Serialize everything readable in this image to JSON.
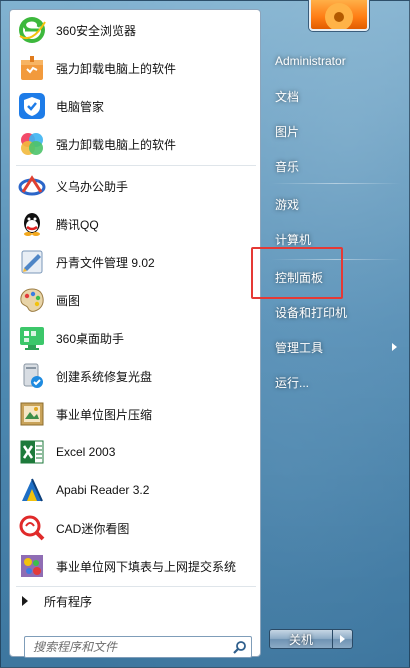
{
  "programs": [
    {
      "label": "360安全浏览器",
      "icon": "360-browser-icon"
    },
    {
      "label": "强力卸载电脑上的软件",
      "icon": "uninstall-box-icon"
    },
    {
      "label": "电脑管家",
      "icon": "tencent-pc-manager-icon"
    },
    {
      "label": "强力卸载电脑上的软件",
      "icon": "colorful-petals-icon"
    },
    {
      "label": "义乌办公助手",
      "icon": "yiwu-office-icon"
    },
    {
      "label": "腾讯QQ",
      "icon": "qq-penguin-icon"
    },
    {
      "label": "丹青文件管理 9.02",
      "icon": "danqing-file-icon"
    },
    {
      "label": "画图",
      "icon": "paint-palette-icon"
    },
    {
      "label": "360桌面助手",
      "icon": "360-desktop-icon"
    },
    {
      "label": "创建系统修复光盘",
      "icon": "repair-disc-icon"
    },
    {
      "label": "事业单位图片压缩",
      "icon": "image-compress-icon"
    },
    {
      "label": "Excel 2003",
      "icon": "excel-icon"
    },
    {
      "label": "Apabi Reader 3.2",
      "icon": "apabi-reader-icon"
    },
    {
      "label": "CAD迷你看图",
      "icon": "cad-viewer-icon"
    },
    {
      "label": "事业单位网下填表与上网提交系统",
      "icon": "form-submit-icon"
    }
  ],
  "all_programs": "所有程序",
  "search": {
    "placeholder": "搜索程序和文件"
  },
  "right_menu": {
    "user": "Administrator",
    "items": [
      {
        "label": "文档"
      },
      {
        "label": "图片"
      },
      {
        "label": "音乐"
      },
      {
        "label": "游戏"
      },
      {
        "label": "计算机"
      },
      {
        "label": "控制面板"
      },
      {
        "label": "设备和打印机"
      },
      {
        "label": "管理工具"
      },
      {
        "label": "运行..."
      }
    ]
  },
  "shutdown": {
    "label": "关机"
  },
  "colors": {
    "highlight": "#e53935",
    "panel": "#ffffff"
  }
}
